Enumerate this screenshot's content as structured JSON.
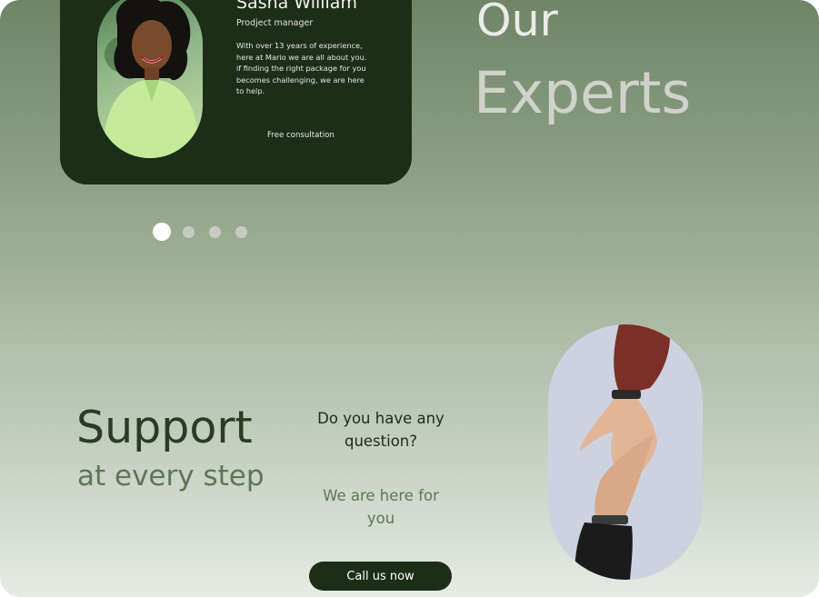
{
  "expert_card": {
    "name": "Sasha William",
    "role": "Prodject manager",
    "bio": "With over 13 years of experience, here at Mario we are all about you. if finding the right package for you becomes challenging, we are here to help.",
    "cta": "Free consultation",
    "photo_icon": "person-portrait-icon"
  },
  "carousel": {
    "dot_count": 4,
    "active_index": 0
  },
  "headline": {
    "line1": "Our",
    "line2": "Experts"
  },
  "support": {
    "title": "Support",
    "subtitle": "at every step",
    "question": "Do you have any question?",
    "tagline": "We are here for you",
    "button": "Call us now",
    "image_icon": "helping-hands-icon"
  },
  "colors": {
    "dark_green": "#1c2e17",
    "mid_green": "#5f7756",
    "background_top": "#6f8566",
    "background_bottom": "#e6ebe4"
  }
}
